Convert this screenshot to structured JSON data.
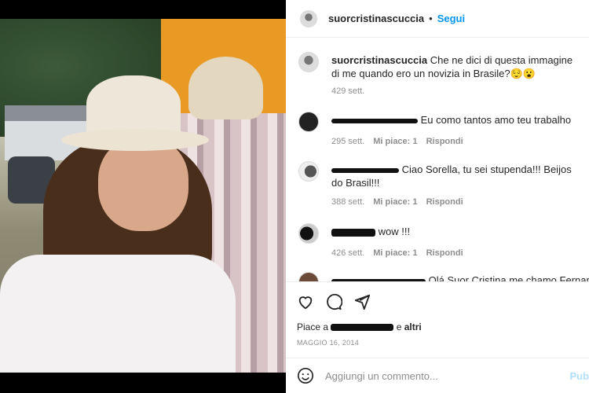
{
  "post": {
    "author": "suorcristinascuccia",
    "separator": "•",
    "follow_label": "Segui"
  },
  "caption": {
    "author": "suorcristinascuccia",
    "text": "Che ne dici di questa immagine di me quando ero un novizia in Brasile?😌😮",
    "time": "429 sett."
  },
  "comments": [
    {
      "text": "Eu como tantos amo teu trabalho",
      "time": "295 sett.",
      "likes": "Mi piace: 1",
      "reply": "Rispondi"
    },
    {
      "text": "Ciao Sorella, tu sei stupenda!!! Beijos do Brasil!!!",
      "time": "388 sett.",
      "likes": "Mi piace: 1",
      "reply": "Rispondi"
    },
    {
      "text": "wow !!!",
      "time": "426 sett.",
      "likes": "Mi piace: 1",
      "reply": "Rispondi"
    },
    {
      "text": "Olá Suor Cristina me chamo Fernanda e",
      "time": "",
      "likes": "",
      "reply": ""
    }
  ],
  "likes_line": {
    "prefix": "Piace a",
    "suffix": "e",
    "others": "altri"
  },
  "date": "MAGGIO 16, 2014",
  "add_comment": {
    "placeholder": "Aggiungi un commento...",
    "post_label": "Pub"
  },
  "icons": [
    "heart-icon",
    "comment-icon",
    "share-icon",
    "emoji-icon"
  ]
}
